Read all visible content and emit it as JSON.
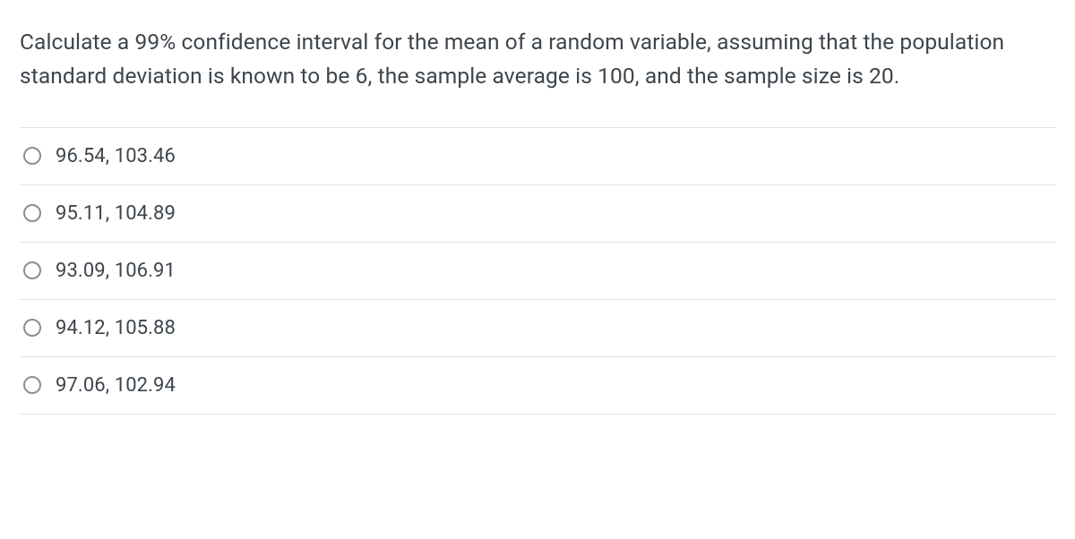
{
  "question": {
    "text": "Calculate a 99% confidence interval for the mean of a random variable, assuming that the population standard deviation is known to be 6, the sample average is 100, and the sample size is 20."
  },
  "options": [
    {
      "label": "96.54, 103.46"
    },
    {
      "label": "95.11, 104.89"
    },
    {
      "label": "93.09, 106.91"
    },
    {
      "label": "94.12, 105.88"
    },
    {
      "label": "97.06, 102.94"
    }
  ]
}
